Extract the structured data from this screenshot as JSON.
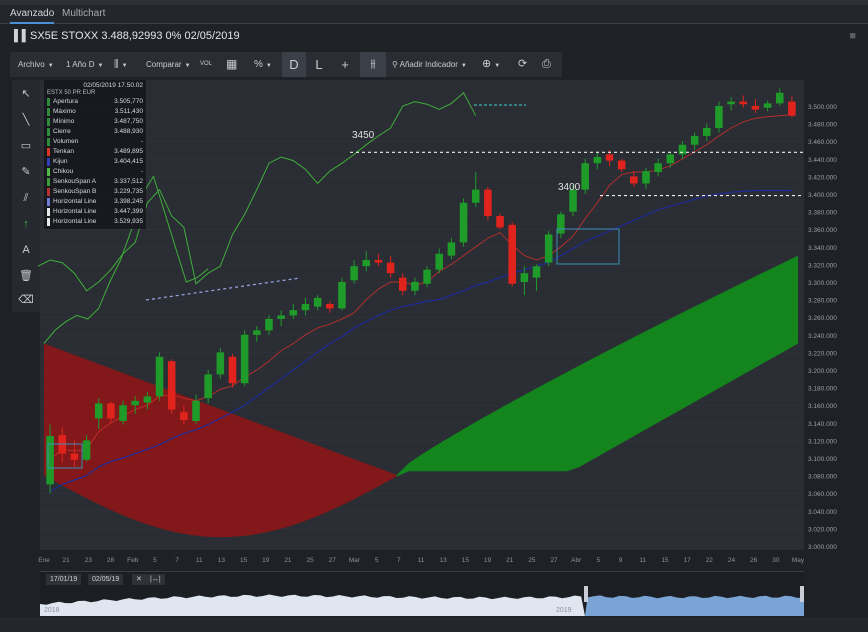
{
  "tabs": [
    {
      "label": "Avanzado",
      "active": true
    },
    {
      "label": "Multichart",
      "active": false
    }
  ],
  "title": "SX5E STOXX 3.488,92993 0% 02/05/2019",
  "toolbar": {
    "archivo": "Archivo",
    "period": "1 Año D",
    "comparar": "Comparar",
    "vol": "VOL",
    "percent": "%",
    "d_button": "D",
    "l_button": "L",
    "add_indicator": "Añadir Indicador"
  },
  "info_panel": {
    "datetime": "02/05/2019 17.50.02",
    "instrument": "ESTX 50 PR EUR",
    "rows": [
      {
        "label": "Apertura",
        "value": "3.505,770",
        "color": "#2e8b3a"
      },
      {
        "label": "Máximo",
        "value": "3.511,430",
        "color": "#2e8b3a"
      },
      {
        "label": "Mínimo",
        "value": "3.487,750",
        "color": "#2e8b3a"
      },
      {
        "label": "Cierre",
        "value": "3.488,930",
        "color": "#2e8b3a"
      },
      {
        "label": "Volumen",
        "value": "-",
        "color": "#2e8b3a"
      },
      {
        "label": "Tenkan",
        "value": "3.489,895",
        "color": "#d9352b"
      },
      {
        "label": "Kijun",
        "value": "3.404,415",
        "color": "#2f3fb8"
      },
      {
        "label": "Chikou",
        "value": "-",
        "color": "#4fb847"
      },
      {
        "label": "SenkouSpan A",
        "value": "3.337,512",
        "color": "#3c9c3c"
      },
      {
        "label": "SenkouSpan B",
        "value": "3.229,735",
        "color": "#b73030"
      },
      {
        "label": "Horizontal Line",
        "value": "3.398,245",
        "color": "#6f7bd8"
      },
      {
        "label": "Horizontal Line",
        "value": "3.447,399",
        "color": "#e8e8e8"
      },
      {
        "label": "Horizontal Line",
        "value": "3.529,935",
        "color": "#e8e8e8"
      }
    ]
  },
  "annotations": {
    "level_3450": "3450",
    "level_3400": "3400"
  },
  "navigator": {
    "from_date": "17/01/19",
    "to_date": "02/05/19",
    "year_left": "2018",
    "year_right": "2019"
  },
  "colors": {
    "up_candle": "#1f9b2a",
    "down_candle": "#e0241d",
    "cloud_bull": "#138a1c",
    "cloud_bear": "#8c1616",
    "tenkan": "#c7302a",
    "kijun": "#1f2b9a",
    "chikou": "#3fae3a"
  },
  "chart_data": {
    "type": "candlestick",
    "ylim": [
      3000,
      3525
    ],
    "y_ticks": [
      "3.000.000",
      "3.020.000",
      "3.040.000",
      "3.060.000",
      "3.080.000",
      "3.100.000",
      "3.120.000",
      "3.140.000",
      "3.160.000",
      "3.180.000",
      "3.200.000",
      "3.220.000",
      "3.240.000",
      "3.260.000",
      "3.280.000",
      "3.300.000",
      "3.320.000",
      "3.340.000",
      "3.360.000",
      "3.380.000",
      "3.400.000",
      "3.420.000",
      "3.440.000",
      "3.460.000",
      "3.480.000",
      "3.500.000"
    ],
    "x_ticks": [
      "Ene",
      "21",
      "23",
      "28",
      "Feb",
      "5",
      "7",
      "11",
      "13",
      "15",
      "19",
      "21",
      "25",
      "27",
      "Mar",
      "5",
      "7",
      "11",
      "13",
      "15",
      "19",
      "21",
      "25",
      "27",
      "Abr",
      "5",
      "9",
      "11",
      "15",
      "17",
      "22",
      "24",
      "26",
      "30",
      "May"
    ],
    "candles": [
      {
        "o": 3070,
        "h": 3138,
        "l": 3060,
        "c": 3125
      },
      {
        "o": 3126,
        "h": 3135,
        "l": 3095,
        "c": 3105
      },
      {
        "o": 3105,
        "h": 3120,
        "l": 3090,
        "c": 3098
      },
      {
        "o": 3098,
        "h": 3126,
        "l": 3096,
        "c": 3120
      },
      {
        "o": 3145,
        "h": 3168,
        "l": 3133,
        "c": 3162
      },
      {
        "o": 3162,
        "h": 3164,
        "l": 3140,
        "c": 3145
      },
      {
        "o": 3142,
        "h": 3165,
        "l": 3138,
        "c": 3160
      },
      {
        "o": 3160,
        "h": 3170,
        "l": 3150,
        "c": 3165
      },
      {
        "o": 3163,
        "h": 3175,
        "l": 3155,
        "c": 3170
      },
      {
        "o": 3170,
        "h": 3220,
        "l": 3165,
        "c": 3215
      },
      {
        "o": 3210,
        "h": 3212,
        "l": 3150,
        "c": 3155
      },
      {
        "o": 3152,
        "h": 3160,
        "l": 3138,
        "c": 3143
      },
      {
        "o": 3142,
        "h": 3172,
        "l": 3139,
        "c": 3165
      },
      {
        "o": 3168,
        "h": 3200,
        "l": 3162,
        "c": 3195
      },
      {
        "o": 3195,
        "h": 3225,
        "l": 3190,
        "c": 3220
      },
      {
        "o": 3215,
        "h": 3218,
        "l": 3180,
        "c": 3185
      },
      {
        "o": 3185,
        "h": 3245,
        "l": 3182,
        "c": 3240
      },
      {
        "o": 3240,
        "h": 3250,
        "l": 3232,
        "c": 3245
      },
      {
        "o": 3245,
        "h": 3262,
        "l": 3240,
        "c": 3258
      },
      {
        "o": 3258,
        "h": 3268,
        "l": 3250,
        "c": 3262
      },
      {
        "o": 3262,
        "h": 3275,
        "l": 3258,
        "c": 3268
      },
      {
        "o": 3268,
        "h": 3282,
        "l": 3262,
        "c": 3275
      },
      {
        "o": 3272,
        "h": 3285,
        "l": 3268,
        "c": 3282
      },
      {
        "o": 3275,
        "h": 3278,
        "l": 3265,
        "c": 3270
      },
      {
        "o": 3270,
        "h": 3305,
        "l": 3268,
        "c": 3300
      },
      {
        "o": 3302,
        "h": 3325,
        "l": 3298,
        "c": 3318
      },
      {
        "o": 3318,
        "h": 3335,
        "l": 3312,
        "c": 3325
      },
      {
        "o": 3325,
        "h": 3332,
        "l": 3318,
        "c": 3322
      },
      {
        "o": 3322,
        "h": 3330,
        "l": 3305,
        "c": 3310
      },
      {
        "o": 3305,
        "h": 3310,
        "l": 3285,
        "c": 3290
      },
      {
        "o": 3290,
        "h": 3305,
        "l": 3285,
        "c": 3300
      },
      {
        "o": 3298,
        "h": 3318,
        "l": 3294,
        "c": 3314
      },
      {
        "o": 3314,
        "h": 3338,
        "l": 3310,
        "c": 3332
      },
      {
        "o": 3330,
        "h": 3350,
        "l": 3326,
        "c": 3345
      },
      {
        "o": 3345,
        "h": 3395,
        "l": 3340,
        "c": 3390
      },
      {
        "o": 3390,
        "h": 3425,
        "l": 3385,
        "c": 3405
      },
      {
        "o": 3405,
        "h": 3408,
        "l": 3370,
        "c": 3375
      },
      {
        "o": 3375,
        "h": 3378,
        "l": 3360,
        "c": 3362
      },
      {
        "o": 3365,
        "h": 3368,
        "l": 3295,
        "c": 3298
      },
      {
        "o": 3300,
        "h": 3318,
        "l": 3285,
        "c": 3310
      },
      {
        "o": 3305,
        "h": 3320,
        "l": 3290,
        "c": 3318
      },
      {
        "o": 3322,
        "h": 3358,
        "l": 3318,
        "c": 3354
      },
      {
        "o": 3355,
        "h": 3380,
        "l": 3350,
        "c": 3377
      },
      {
        "o": 3380,
        "h": 3410,
        "l": 3375,
        "c": 3405
      },
      {
        "o": 3405,
        "h": 3440,
        "l": 3400,
        "c": 3435
      },
      {
        "o": 3435,
        "h": 3448,
        "l": 3428,
        "c": 3442
      },
      {
        "o": 3445,
        "h": 3450,
        "l": 3432,
        "c": 3438
      },
      {
        "o": 3438,
        "h": 3440,
        "l": 3425,
        "c": 3428
      },
      {
        "o": 3420,
        "h": 3426,
        "l": 3408,
        "c": 3412
      },
      {
        "o": 3412,
        "h": 3430,
        "l": 3406,
        "c": 3426
      },
      {
        "o": 3425,
        "h": 3440,
        "l": 3420,
        "c": 3435
      },
      {
        "o": 3435,
        "h": 3448,
        "l": 3430,
        "c": 3445
      },
      {
        "o": 3445,
        "h": 3460,
        "l": 3440,
        "c": 3456
      },
      {
        "o": 3456,
        "h": 3470,
        "l": 3450,
        "c": 3466
      },
      {
        "o": 3466,
        "h": 3480,
        "l": 3460,
        "c": 3475
      },
      {
        "o": 3475,
        "h": 3505,
        "l": 3470,
        "c": 3500
      },
      {
        "o": 3502,
        "h": 3510,
        "l": 3495,
        "c": 3505
      },
      {
        "o": 3505,
        "h": 3512,
        "l": 3498,
        "c": 3502
      },
      {
        "o": 3500,
        "h": 3508,
        "l": 3492,
        "c": 3496
      },
      {
        "o": 3498,
        "h": 3506,
        "l": 3494,
        "c": 3503
      },
      {
        "o": 3503,
        "h": 3520,
        "l": 3500,
        "c": 3515
      },
      {
        "o": 3505,
        "h": 3511,
        "l": 3487,
        "c": 3489
      }
    ],
    "tenkan": [
      3098,
      3110,
      3108,
      3110,
      3130,
      3140,
      3148,
      3155,
      3160,
      3170,
      3172,
      3168,
      3165,
      3170,
      3178,
      3182,
      3192,
      3200,
      3210,
      3222,
      3230,
      3240,
      3248,
      3252,
      3258,
      3265,
      3280,
      3292,
      3300,
      3300,
      3296,
      3300,
      3312,
      3320,
      3330,
      3340,
      3350,
      3356,
      3342,
      3330,
      3325,
      3330,
      3340,
      3352,
      3372,
      3390,
      3410,
      3422,
      3425,
      3425,
      3427,
      3432,
      3440,
      3448,
      3456,
      3466,
      3475,
      3482,
      3486,
      3488,
      3489,
      3490
    ],
    "kijun": [
      3062,
      3070,
      3075,
      3080,
      3090,
      3096,
      3100,
      3105,
      3110,
      3115,
      3122,
      3128,
      3132,
      3138,
      3145,
      3152,
      3160,
      3170,
      3180,
      3190,
      3200,
      3210,
      3220,
      3230,
      3238,
      3248,
      3255,
      3262,
      3268,
      3272,
      3275,
      3278,
      3280,
      3285,
      3290,
      3296,
      3300,
      3305,
      3310,
      3314,
      3318,
      3322,
      3330,
      3338,
      3346,
      3352,
      3358,
      3364,
      3370,
      3376,
      3382,
      3386,
      3390,
      3394,
      3398,
      3400,
      3402,
      3403,
      3404,
      3404,
      3404,
      3404
    ],
    "cloud_note": "Ichimoku cloud: Senkou Span A and B projected forward",
    "horizontal_lines": [
      3447.399,
      3398.245
    ]
  }
}
